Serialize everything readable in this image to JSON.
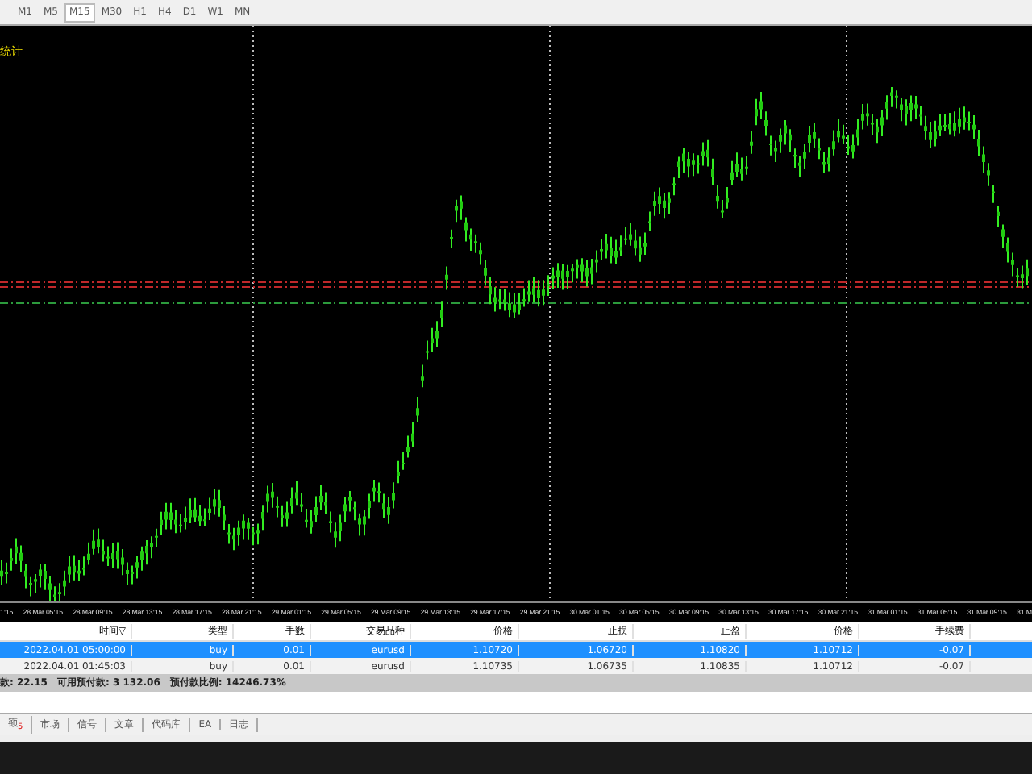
{
  "toolbar": {
    "timeframes": [
      {
        "label": "M1",
        "selected": false
      },
      {
        "label": "M5",
        "selected": false
      },
      {
        "label": "M15",
        "selected": true
      },
      {
        "label": "M30",
        "selected": false
      },
      {
        "label": "H1",
        "selected": false
      },
      {
        "label": "H4",
        "selected": false
      },
      {
        "label": "D1",
        "selected": false
      },
      {
        "label": "W1",
        "selected": false
      },
      {
        "label": "MN",
        "selected": false
      }
    ]
  },
  "chart": {
    "indicator_label": "统计",
    "time_labels": [
      "1:15",
      "28 Mar 05:15",
      "28 Mar 09:15",
      "28 Mar 13:15",
      "28 Mar 17:15",
      "28 Mar 21:15",
      "29 Mar 01:15",
      "29 Mar 05:15",
      "29 Mar 09:15",
      "29 Mar 13:15",
      "29 Mar 17:15",
      "29 Mar 21:15",
      "30 Mar 01:15",
      "30 Mar 05:15",
      "30 Mar 09:15",
      "30 Mar 13:15",
      "30 Mar 17:15",
      "30 Mar 21:15",
      "31 Mar 01:15",
      "31 Mar 05:15",
      "31 Mar 09:15",
      "31 M"
    ]
  },
  "table": {
    "columns": [
      "时间",
      "类型",
      "手数",
      "交易品种",
      "价格",
      "止损",
      "止盈",
      "价格",
      "手续费"
    ],
    "sort_mark": "▽",
    "rows": [
      {
        "selected": true,
        "cells": [
          "2022.04.01 05:00:00",
          "buy",
          "0.01",
          "eurusd",
          "1.10720",
          "1.06720",
          "1.10820",
          "1.10712",
          "-0.07"
        ]
      },
      {
        "selected": false,
        "cells": [
          "2022.04.01 01:45:03",
          "buy",
          "0.01",
          "eurusd",
          "1.10735",
          "1.06735",
          "1.10835",
          "1.10712",
          "-0.07"
        ]
      }
    ]
  },
  "status_bar": [
    "款: 22.15",
    "可用预付款: 3 132.06",
    "预付款比例: 14246.73%"
  ],
  "bottom_tabs": [
    {
      "label": "额",
      "badge": "5"
    },
    {
      "label": "市场"
    },
    {
      "label": "信号"
    },
    {
      "label": "文章"
    },
    {
      "label": "代码库"
    },
    {
      "label": "EA"
    },
    {
      "label": "日志"
    }
  ]
}
